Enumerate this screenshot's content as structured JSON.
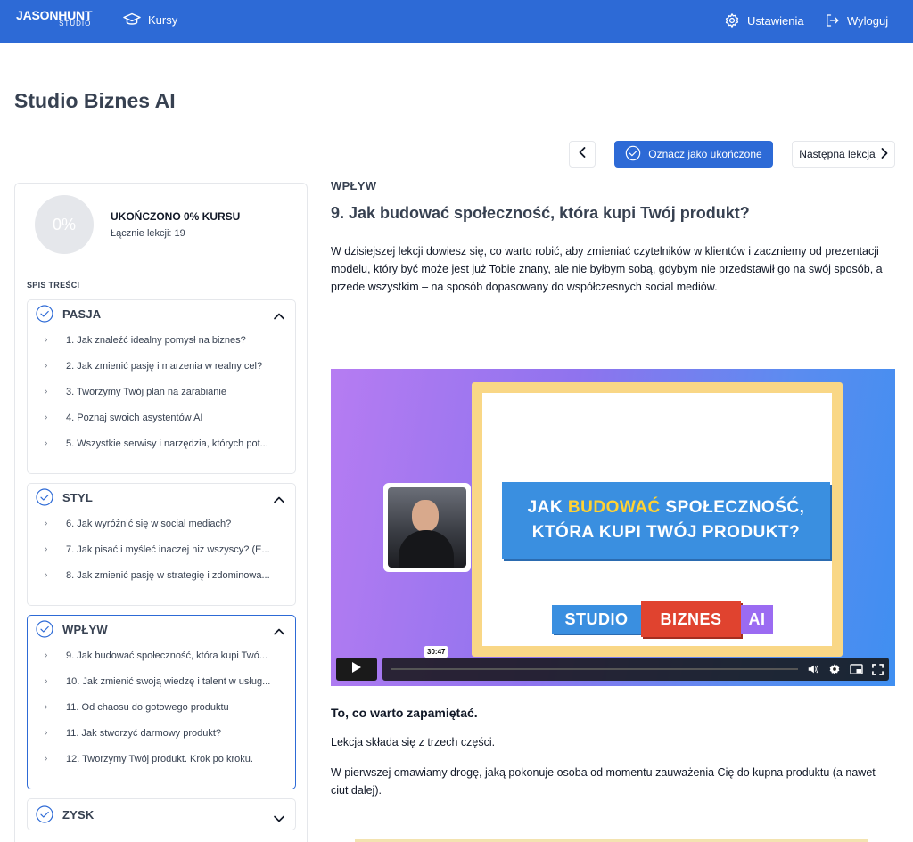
{
  "header": {
    "logo_line1": "JASONHUNT",
    "logo_line2": "STUDIO",
    "courses_label": "Kursy",
    "settings_label": "Ustawienia",
    "logout_label": "Wyloguj",
    "bg_color": "#2d6ad6"
  },
  "page_title": "Studio Biznes AI",
  "lesson_nav": {
    "complete_label": "Oznacz jako ukończone",
    "next_label": "Następna lekcja"
  },
  "sidebar": {
    "progress_percent_label": "0%",
    "progress_title": "UKOŃCZONO 0% KURSU",
    "total_lessons": "Łącznie lekcji: 19",
    "toc_label": "SPIS TREŚCI",
    "sections": [
      {
        "title": "PASJA",
        "expanded": true,
        "lessons": [
          "1. Jak znaleźć idealny pomysł na biznes?",
          "2. Jak zmienić pasję i marzenia w realny cel?",
          "3. Tworzymy Twój plan na zarabianie",
          "4. Poznaj swoich asystentów AI",
          "5. Wszystkie serwisy i narzędzia, których pot..."
        ]
      },
      {
        "title": "STYL",
        "expanded": true,
        "lessons": [
          "6. Jak wyróżnić się w social mediach?",
          "7. Jak pisać i myśleć inaczej niż wszyscy? (E...",
          "8. Jak zmienić pasję w strategię i zdominowa..."
        ]
      },
      {
        "title": "WPŁYW",
        "expanded": true,
        "active": true,
        "lessons": [
          "9. Jak budować społeczność, która kupi Twó...",
          "10. Jak zmienić swoją wiedzę i talent w usług...",
          "11. Od chaosu do gotowego produktu",
          "11. Jak stworzyć darmowy produkt?",
          "12. Tworzymy Twój produkt. Krok po kroku."
        ]
      },
      {
        "title": "ZYSK",
        "expanded": false,
        "lessons": []
      }
    ]
  },
  "main": {
    "section_eyebrow": "WPŁYW",
    "lesson_title": "9. Jak budować społeczność, która kupi Twój produkt?",
    "intro": "W dzisiejszej lekcji dowiesz się, co warto robić, aby zmieniać czytelników w klientów i zaczniemy od prezentacji modelu, który być może jest już Tobie znany, ale nie byłbym sobą, gdybym nie przedstawił go na swój sposób, a przede wszystkim – na sposób dopasowany do współczesnych social mediów.",
    "video": {
      "banner_line1_pre": "JAK ",
      "banner_line1_hl": "BUDOWAĆ",
      "banner_line1_post": " SPOŁECZNOŚĆ,",
      "banner_line2": "KTÓRA KUPI TWÓJ PRODUKT?",
      "brand_1": "STUDIO",
      "brand_2": "BIZNES",
      "brand_3": "AI",
      "time_label": "30:47"
    },
    "remember_title": "To, co warto zapamiętać.",
    "paragraph_1": "Lekcja składa się z trzech części.",
    "paragraph_2": "W pierwszej omawiamy drogę, jaką pokonuje osoba od momentu zauważenia Cię do kupna produktu (a nawet ciut dalej)."
  }
}
